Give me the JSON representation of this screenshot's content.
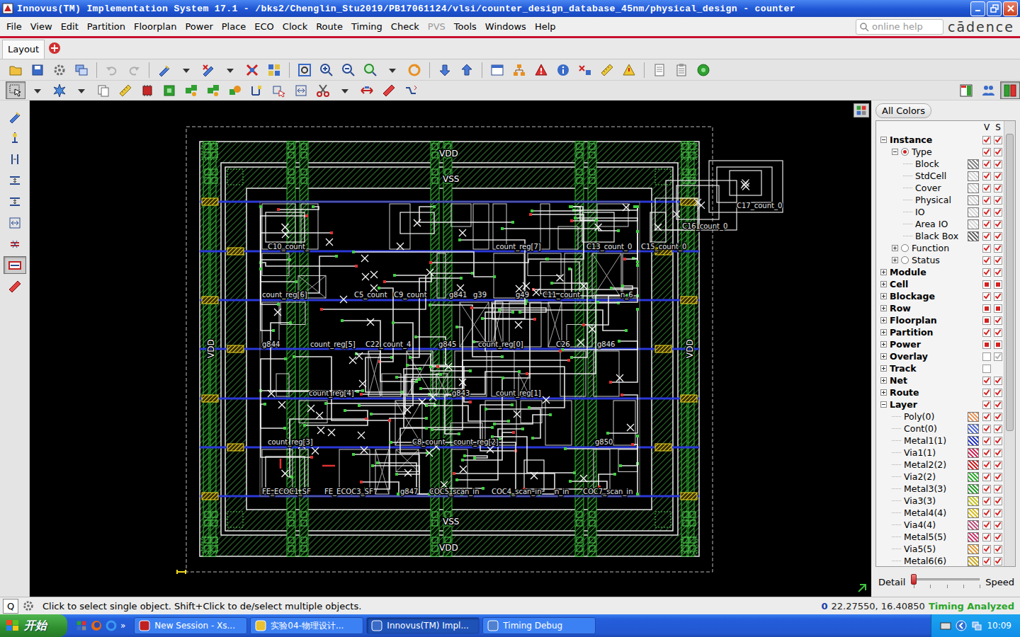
{
  "window": {
    "title": "Innovus(TM) Implementation System 17.1 - /bks2/Chenglin_Stu2019/PB17061124/vlsi/counter_design_database_45nm/physical_design - counter"
  },
  "menu": [
    {
      "label": "File",
      "disabled": false
    },
    {
      "label": "View",
      "disabled": false
    },
    {
      "label": "Edit",
      "disabled": false
    },
    {
      "label": "Partition",
      "disabled": false
    },
    {
      "label": "Floorplan",
      "disabled": false
    },
    {
      "label": "Power",
      "disabled": false
    },
    {
      "label": "Place",
      "disabled": false
    },
    {
      "label": "ECO",
      "disabled": false
    },
    {
      "label": "Clock",
      "disabled": false
    },
    {
      "label": "Route",
      "disabled": false
    },
    {
      "label": "Timing",
      "disabled": false
    },
    {
      "label": "Check",
      "disabled": false
    },
    {
      "label": "PVS",
      "disabled": true
    },
    {
      "label": "Tools",
      "disabled": false
    },
    {
      "label": "Windows",
      "disabled": false
    },
    {
      "label": "Help",
      "disabled": false
    }
  ],
  "search": {
    "placeholder": "online help"
  },
  "logo": "cādence",
  "tabs": [
    {
      "label": "Layout",
      "selected": true
    }
  ],
  "toolbar_second": {
    "tools": [
      {
        "pressed": true
      },
      {
        "pressed": false
      },
      {
        "pressed": false
      },
      {
        "pressed": false
      },
      {
        "pressed": false
      },
      {
        "pressed": false
      },
      {
        "pressed": false
      },
      {
        "pressed": false
      },
      {
        "pressed": false
      },
      {
        "pressed": false
      },
      {
        "pressed": false
      },
      {
        "pressed": false
      },
      {
        "pressed": false
      },
      {
        "pressed": false
      },
      {
        "pressed": false
      },
      {
        "pressed": false
      }
    ],
    "right": [
      {
        "pressed": false
      },
      {
        "pressed": false
      },
      {
        "pressed": true
      }
    ]
  },
  "left_toolbar": [
    {
      "pressed": false
    },
    {
      "pressed": false
    },
    {
      "pressed": false
    },
    {
      "pressed": false
    },
    {
      "pressed": false
    },
    {
      "pressed": false
    },
    {
      "pressed": false
    },
    {
      "pressed": true
    },
    {
      "pressed": false
    }
  ],
  "layout": {
    "power_labels": [
      "VDD",
      "VSS",
      "VSS",
      "VDD",
      "VDD",
      "VDD"
    ],
    "cell_labels": [
      "C10_count_",
      "count_reg[7]",
      "C13_count_0",
      "C15_count_0",
      "C17_count_0",
      "C16_count_0",
      "count_reg[6]",
      "C5_count",
      "C9_count",
      "g841",
      "g39",
      "g49",
      "C11_count",
      "n_6",
      "g844",
      "count_reg[5]",
      "C22_count_4",
      "g845",
      "count_reg[0]",
      "C26",
      "g846",
      "count_reg[4]",
      "g843",
      "count_reg[1]",
      "count_reg[3]",
      "C8_count",
      "count_reg[2]",
      "g850",
      "FE_ECOC1_SF",
      "FE_ECOC3_SF",
      "g847",
      "COC5_scan_in",
      "COC4_scan_in",
      "n_in",
      "COC7_scan_in"
    ]
  },
  "panel": {
    "all_colors": "All Colors",
    "columns": [
      "V",
      "S"
    ],
    "tree": [
      {
        "label": "Instance",
        "depth": 0,
        "kind": "group",
        "expanded": true,
        "v": "checked",
        "s": "checked"
      },
      {
        "label": "Type",
        "depth": 1,
        "kind": "radio-group",
        "expanded": true,
        "selected": true,
        "v": "checked",
        "s": "checked"
      },
      {
        "label": "Block",
        "depth": 2,
        "kind": "leaf",
        "color": "#8c8c8c",
        "v": "checked",
        "s": "checked"
      },
      {
        "label": "StdCell",
        "depth": 2,
        "kind": "leaf",
        "color": "#d8d8d8",
        "v": "checked",
        "s": "checked"
      },
      {
        "label": "Cover",
        "depth": 2,
        "kind": "leaf",
        "color": "#d8d8d8",
        "v": "checked",
        "s": "checked"
      },
      {
        "label": "Physical",
        "depth": 2,
        "kind": "leaf",
        "color": "#d8d8d8",
        "v": "checked",
        "s": "checked"
      },
      {
        "label": "IO",
        "depth": 2,
        "kind": "leaf",
        "color": "#d8d8d8",
        "v": "checked",
        "s": "checked"
      },
      {
        "label": "Area IO",
        "depth": 2,
        "kind": "leaf",
        "color": "#d8d8d8",
        "v": "checked",
        "s": "checked"
      },
      {
        "label": "Black Box",
        "depth": 2,
        "kind": "leaf",
        "color": "#6e6e6e",
        "v": "checked",
        "s": "checked"
      },
      {
        "label": "Function",
        "depth": 1,
        "kind": "radio-group",
        "expanded": false,
        "selected": false,
        "v": "checked",
        "s": "checked"
      },
      {
        "label": "Status",
        "depth": 1,
        "kind": "radio-group",
        "expanded": false,
        "selected": false,
        "v": "checked",
        "s": "checked"
      },
      {
        "label": "Module",
        "depth": 0,
        "kind": "group",
        "expanded": false,
        "v": "checked",
        "s": "checked"
      },
      {
        "label": "Cell",
        "depth": 0,
        "kind": "group",
        "expanded": false,
        "v": "partial",
        "s": "partial"
      },
      {
        "label": "Blockage",
        "depth": 0,
        "kind": "group",
        "expanded": false,
        "v": "checked",
        "s": "checked"
      },
      {
        "label": "Row",
        "depth": 0,
        "kind": "group",
        "expanded": false,
        "v": "partial",
        "s": "partial"
      },
      {
        "label": "Floorplan",
        "depth": 0,
        "kind": "group",
        "expanded": false,
        "v": "partial",
        "s": "checked"
      },
      {
        "label": "Partition",
        "depth": 0,
        "kind": "group",
        "expanded": false,
        "v": "checked",
        "s": "checked"
      },
      {
        "label": "Power",
        "depth": 0,
        "kind": "group",
        "expanded": false,
        "v": "partial",
        "s": "partial"
      },
      {
        "label": "Overlay",
        "depth": 0,
        "kind": "group",
        "expanded": false,
        "v": "off",
        "s": "dim"
      },
      {
        "label": "Track",
        "depth": 0,
        "kind": "group",
        "expanded": false,
        "v": "off",
        "s": "none"
      },
      {
        "label": "Net",
        "depth": 0,
        "kind": "group",
        "expanded": false,
        "v": "checked",
        "s": "checked"
      },
      {
        "label": "Route",
        "depth": 0,
        "kind": "group",
        "expanded": false,
        "v": "checked",
        "s": "checked"
      },
      {
        "label": "Layer",
        "depth": 0,
        "kind": "group",
        "expanded": true,
        "v": "checked",
        "s": "checked"
      },
      {
        "label": "Poly(0)",
        "depth": 1,
        "kind": "leaf",
        "color": "#e89a60",
        "v": "checked",
        "s": "checked"
      },
      {
        "label": "Cont(0)",
        "depth": 1,
        "kind": "leaf",
        "color": "#5a70d8",
        "v": "checked",
        "s": "checked"
      },
      {
        "label": "Metal1(1)",
        "depth": 1,
        "kind": "leaf",
        "color": "#3040c8",
        "v": "checked",
        "s": "checked"
      },
      {
        "label": "Via1(1)",
        "depth": 1,
        "kind": "leaf",
        "color": "#d03060",
        "v": "checked",
        "s": "checked"
      },
      {
        "label": "Metal2(2)",
        "depth": 1,
        "kind": "leaf",
        "color": "#d02828",
        "v": "checked",
        "s": "checked"
      },
      {
        "label": "Via2(2)",
        "depth": 1,
        "kind": "leaf",
        "color": "#38b038",
        "v": "checked",
        "s": "checked"
      },
      {
        "label": "Metal3(3)",
        "depth": 1,
        "kind": "leaf",
        "color": "#30a030",
        "v": "checked",
        "s": "checked"
      },
      {
        "label": "Via3(3)",
        "depth": 1,
        "kind": "leaf",
        "color": "#c8c830",
        "v": "checked",
        "s": "checked"
      },
      {
        "label": "Metal4(4)",
        "depth": 1,
        "kind": "leaf",
        "color": "#d8c030",
        "v": "checked",
        "s": "checked"
      },
      {
        "label": "Via4(4)",
        "depth": 1,
        "kind": "leaf",
        "color": "#c05880",
        "v": "checked",
        "s": "checked"
      },
      {
        "label": "Metal5(5)",
        "depth": 1,
        "kind": "leaf",
        "color": "#d04070",
        "v": "checked",
        "s": "checked"
      },
      {
        "label": "Via5(5)",
        "depth": 1,
        "kind": "leaf",
        "color": "#e0a040",
        "v": "checked",
        "s": "checked"
      },
      {
        "label": "Metal6(6)",
        "depth": 1,
        "kind": "leaf",
        "color": "#d0b030",
        "v": "checked",
        "s": "checked"
      }
    ],
    "detail": {
      "label": "Detail",
      "end": "Speed",
      "level": 0.0
    }
  },
  "status_bar": {
    "q": "Q",
    "message": "Click to select single object. Shift+Click to de/select multiple objects.",
    "count": "0",
    "coords": "22.27550, 16.40850",
    "timing": "Timing Analyzed"
  },
  "taskbar": {
    "start": "开始",
    "more": "»",
    "tasks": [
      {
        "label": "New Session - Xs...",
        "selected": false
      },
      {
        "label": "实验04-物理设计...",
        "selected": false
      },
      {
        "label": "Innovus(TM) Impl...",
        "selected": true
      },
      {
        "label": "Timing Debug",
        "selected": false
      }
    ],
    "time": "10:09"
  }
}
